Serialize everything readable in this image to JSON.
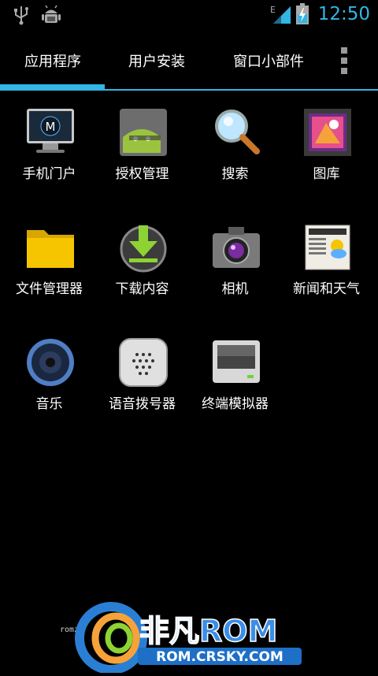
{
  "statusbar": {
    "time": "12:50",
    "network": "E",
    "icons": [
      "usb-icon",
      "android-debug-icon",
      "signal-icon",
      "battery-charging-icon"
    ],
    "accent": "#33b5e5"
  },
  "tabs": [
    {
      "label": "应用程序",
      "selected": true
    },
    {
      "label": "用户安装",
      "selected": false
    },
    {
      "label": "窗口小部件",
      "selected": false
    }
  ],
  "apps": [
    {
      "label": "手机门户",
      "icon": "motorola-monitor-icon"
    },
    {
      "label": "授权管理",
      "icon": "android-superuser-icon"
    },
    {
      "label": "搜索",
      "icon": "magnifier-icon"
    },
    {
      "label": "图库",
      "icon": "gallery-icon"
    },
    {
      "label": "文件管理器",
      "icon": "folder-icon"
    },
    {
      "label": "下载内容",
      "icon": "download-icon"
    },
    {
      "label": "相机",
      "icon": "camera-icon"
    },
    {
      "label": "新闻和天气",
      "icon": "news-weather-icon"
    },
    {
      "label": "音乐",
      "icon": "speaker-icon"
    },
    {
      "label": "语音拨号器",
      "icon": "voice-dialer-icon"
    },
    {
      "label": "终端模拟器",
      "icon": "terminal-icon"
    }
  ],
  "watermark": {
    "brand": "非凡ROM",
    "url": "ROM.CRSKY.COM",
    "small": "romz"
  }
}
